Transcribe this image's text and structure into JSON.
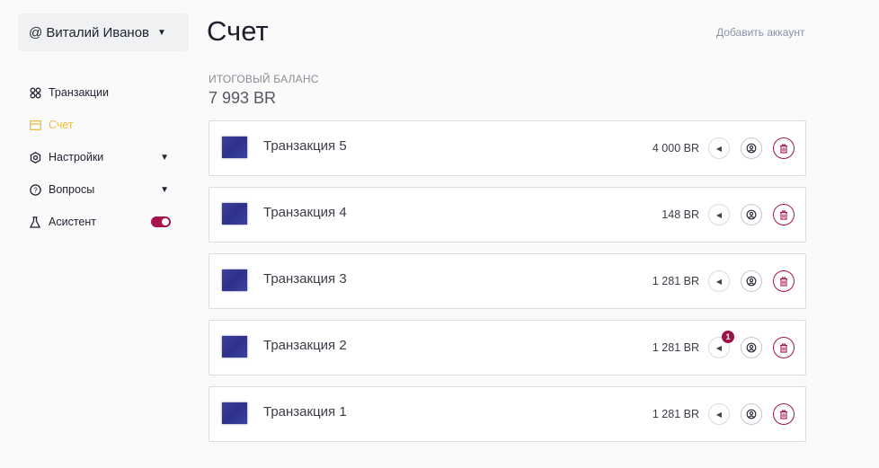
{
  "user": {
    "name": "@ Виталий Иванов"
  },
  "sidebar": {
    "items": [
      {
        "label": "Транзакции",
        "icon": "grid-icon",
        "active": false
      },
      {
        "label": "Счет",
        "icon": "card-icon",
        "active": true
      },
      {
        "label": "Настройки",
        "icon": "gear-icon",
        "active": false,
        "expandable": true
      },
      {
        "label": "Вопросы",
        "icon": "help-icon",
        "active": false,
        "expandable": true
      },
      {
        "label": "Асистент",
        "icon": "flask-icon",
        "active": false,
        "toggle": true
      }
    ]
  },
  "header": {
    "title": "Счет",
    "add_account": "Добавить аккаунт"
  },
  "balance": {
    "label": "ИТОГОВЫЙ БАЛАНС",
    "value": "7 993 BR"
  },
  "transactions": [
    {
      "name": "Транзакция 5",
      "amount": "4 000 BR"
    },
    {
      "name": "Транзакция 4",
      "amount": "148 BR"
    },
    {
      "name": "Транзакция 3",
      "amount": "1 281 BR"
    },
    {
      "name": "Транзакция 2",
      "amount": "1 281 BR",
      "badge": "1"
    },
    {
      "name": "Транзакция 1",
      "amount": "1 281 BR"
    }
  ],
  "colors": {
    "accent": "#a8124e",
    "active_nav": "#e9bf43"
  }
}
